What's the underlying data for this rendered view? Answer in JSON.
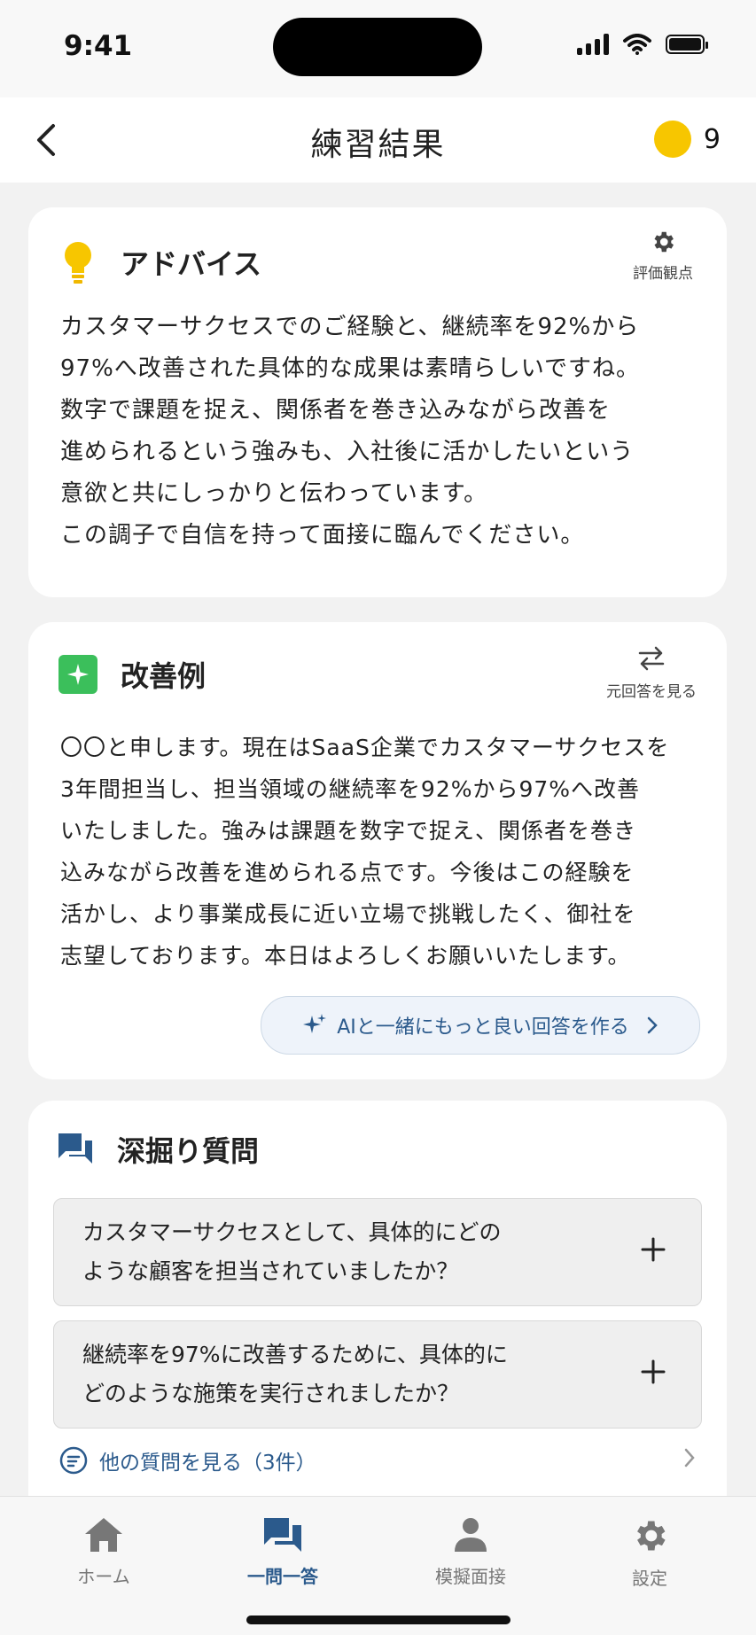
{
  "status": {
    "time": "9:41"
  },
  "header": {
    "title": "練習結果",
    "coin_count": "9",
    "coin_color": "#f7c600"
  },
  "advice": {
    "title": "アドバイス",
    "action_label": "評価観点",
    "body": "カスタマーサクセスでのご経験と、継続率を92%から\n97%へ改善された具体的な成果は素晴らしいですね。\n数字で課題を捉え、関係者を巻き込みながら改善を\n進められるという強みも、入社後に活かしたいという\n意欲と共にしっかりと伝わっています。\nこの調子で自信を持って面接に臨んでください。"
  },
  "improvement": {
    "title": "改善例",
    "action_label": "元回答を見る",
    "body": "〇〇と申します。現在はSaaS企業でカスタマーサクセスを\n3年間担当し、担当領域の継続率を92%から97%へ改善\nいたしました。強みは課題を数字で捉え、関係者を巻き\n込みながら改善を進められる点です。今後はこの経験を\n活かし、より事業成長に近い立場で挑戦したく、御社を\n志望しております。本日はよろしくお願いいたします。",
    "ai_button_label": "AIと一緒にもっと良い回答を作る"
  },
  "followup": {
    "title": "深掘り質問",
    "questions": [
      "カスタマーサクセスとして、具体的にどの\nような顧客を担当されていましたか？",
      "継続率を97%に改善するために、具体的に\nどのような施策を実行されましたか？"
    ],
    "more_label": "他の質問を見る（3件）"
  },
  "tabs": [
    {
      "label": "ホーム",
      "icon": "home-icon"
    },
    {
      "label": "一問一答",
      "icon": "chat-icon",
      "active": true
    },
    {
      "label": "模擬面接",
      "icon": "person-icon"
    },
    {
      "label": "設定",
      "icon": "gear-icon"
    }
  ],
  "colors": {
    "accent": "#2b5a8c",
    "spark_green": "#3bbf5b",
    "bulb_yellow": "#f7c600"
  }
}
